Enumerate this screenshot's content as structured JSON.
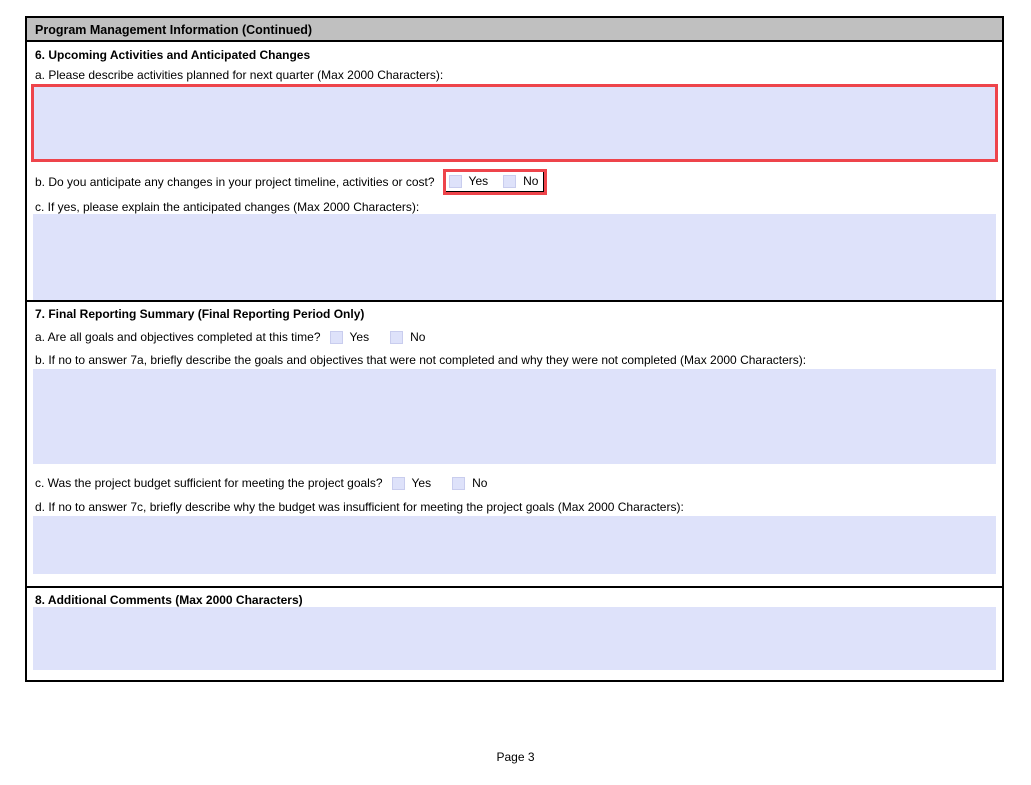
{
  "page": {
    "header_title": "Program Management Information (Continued)",
    "footer": "Page 3"
  },
  "colors": {
    "header_bg": "#c0c0c0",
    "field_bg": "#dee2fa",
    "required_highlight": "#ee444b"
  },
  "section6": {
    "title": "6. Upcoming Activities and Anticipated Changes",
    "qa_label": "a. Please describe activities planned for next quarter (Max 2000 Characters):",
    "qa_value": "",
    "qb_label": "b. Do you anticipate any changes in your project timeline, activities or cost?",
    "qb_yes_label": "Yes",
    "qb_no_label": "No",
    "qb_yes_checked": false,
    "qb_no_checked": false,
    "qc_label": "c. If yes, please explain the anticipated changes (Max 2000 Characters):",
    "qc_value": ""
  },
  "section7": {
    "title": "7. Final Reporting Summary (Final Reporting Period Only)",
    "qa_label": "a. Are all goals and objectives completed at this time?",
    "qa_yes_label": "Yes",
    "qa_no_label": "No",
    "qa_yes_checked": false,
    "qa_no_checked": false,
    "qb_label": "b. If no to answer 7a, briefly describe the goals and objectives that were not completed and why they were not completed (Max 2000 Characters):",
    "qb_value": "",
    "qc_label": "c. Was the project budget sufficient for meeting the project goals?",
    "qc_yes_label": "Yes",
    "qc_no_label": "No",
    "qc_yes_checked": false,
    "qc_no_checked": false,
    "qd_label": "d. If no to answer 7c, briefly describe why the budget was insufficient for meeting the project goals (Max 2000 Characters):",
    "qd_value": ""
  },
  "section8": {
    "title": "8. Additional Comments (Max 2000 Characters)",
    "value": ""
  }
}
